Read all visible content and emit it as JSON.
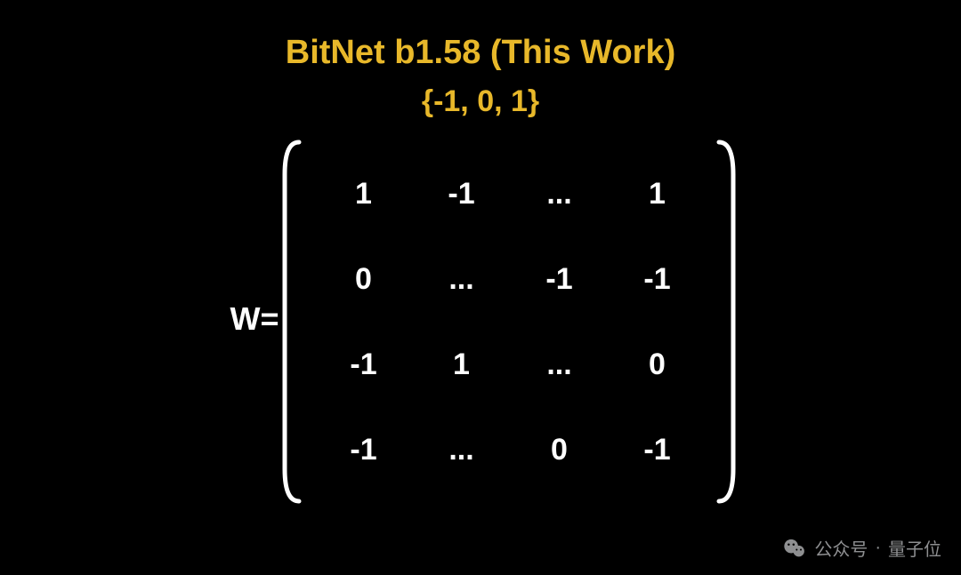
{
  "title": "BitNet b1.58 (This Work)",
  "subtitle": "{-1, 0, 1}",
  "matrix_label": "W=",
  "matrix": [
    [
      "1",
      "-1",
      "...",
      "1"
    ],
    [
      "0",
      "...",
      "-1",
      "-1"
    ],
    [
      "-1",
      "1",
      "...",
      "0"
    ],
    [
      "-1",
      "...",
      "0",
      "-1"
    ]
  ],
  "watermark": {
    "prefix": "公众号",
    "sep": "·",
    "name": "量子位"
  },
  "colors": {
    "background": "#000000",
    "accent": "#e8b82a",
    "text": "#ffffff",
    "watermark": "#8e8f91"
  }
}
